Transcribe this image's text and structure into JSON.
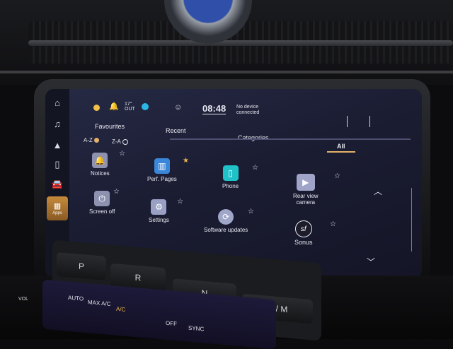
{
  "status": {
    "temperature": "17°",
    "temp_unit": "OUT",
    "time": "08:48",
    "device_line1": "No device",
    "device_line2": "connected"
  },
  "tabs": {
    "favourites": "Favourites",
    "recent": "Recent",
    "categories": "Categories",
    "all": "All"
  },
  "sort": {
    "az": "A-Z",
    "za": "Z-A"
  },
  "sidebar": {
    "apps_label": "Apps"
  },
  "apps": [
    {
      "label": "Notices",
      "color": "#8e92b0",
      "favourite": false
    },
    {
      "label": "Perf. Pages",
      "color": "#3a86d8",
      "favourite": true
    },
    {
      "label": "Phone",
      "color": "#1fc2c9",
      "favourite": false
    },
    {
      "label": "Rear view camera",
      "label1": "Rear view",
      "label2": "camera",
      "color": "#9fa4c8",
      "favourite": false
    },
    {
      "label": "Screen off",
      "color": "#8e92b0",
      "favourite": false
    },
    {
      "label": "Settings",
      "color": "#9aa0c4",
      "favourite": false
    },
    {
      "label": "Software updates",
      "color": "#a0a6c8",
      "favourite": false
    },
    {
      "label": "Sonus",
      "color": "#1c1c2a",
      "favourite": false
    }
  ],
  "gear": {
    "p": "P",
    "r": "R",
    "n": "N",
    "d": "D / M"
  },
  "climate": {
    "auto": "AUTO",
    "max_ac": "MAX A/C",
    "ac": "A/C",
    "off": "OFF",
    "sync": "SYNC",
    "vol": "VOL"
  },
  "colors": {
    "accent": "#e4b16a",
    "screen_bg": "#1b1d33"
  }
}
